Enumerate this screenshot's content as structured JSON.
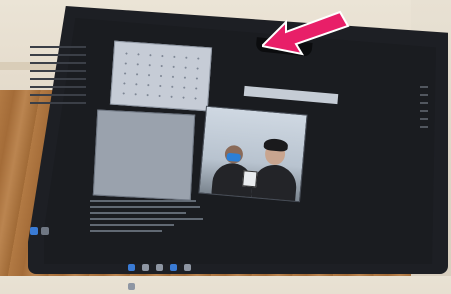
{
  "scene": {
    "description_colors": {
      "wall": "#e6dfd1",
      "floor": "#a86f3b",
      "laptop_bezel": "#1d1f24",
      "arrow": "#e81f68",
      "mask": "#2b7fd6"
    },
    "icons": {
      "arrow": "pointer-arrow-icon",
      "camera": "webcam-icon",
      "taskbar": "taskbar-app-icons"
    }
  }
}
